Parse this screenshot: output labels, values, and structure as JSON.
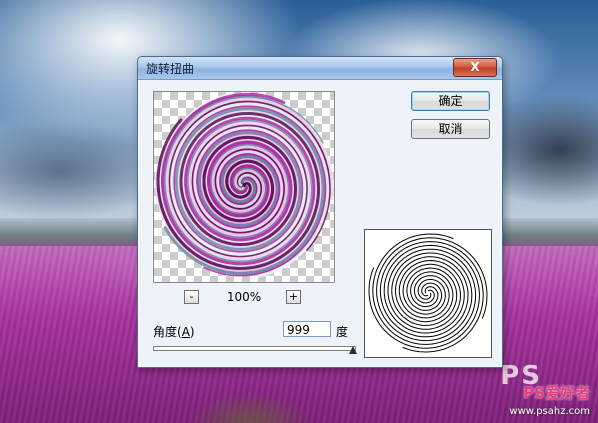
{
  "dialog": {
    "title": "旋转扭曲",
    "close_label": "X",
    "ok_label": "确定",
    "cancel_label": "取消",
    "zoom": {
      "minus_label": "-",
      "plus_label": "+",
      "value": "100%"
    },
    "angle": {
      "label": "角度(",
      "hotkey": "A",
      "label_end": ")",
      "value": "999",
      "unit": "度"
    },
    "slider_position": 0.996
  },
  "watermark": {
    "logo": "PS",
    "subtitle": "PS爱好者",
    "url": "www.psahz.com"
  },
  "colors": {
    "swirl_magenta": "#b42aa8",
    "swirl_white": "#eef4f8",
    "swirl_steel": "#6f8fa6",
    "dialog_bg": "#eef3f9",
    "titlebar": "#a9c6ea",
    "close_button": "#c9472b"
  },
  "icons": {
    "close": "close-icon",
    "zoom_out": "minus-icon",
    "zoom_in": "plus-icon",
    "slider": "triangle-thumb-icon"
  }
}
